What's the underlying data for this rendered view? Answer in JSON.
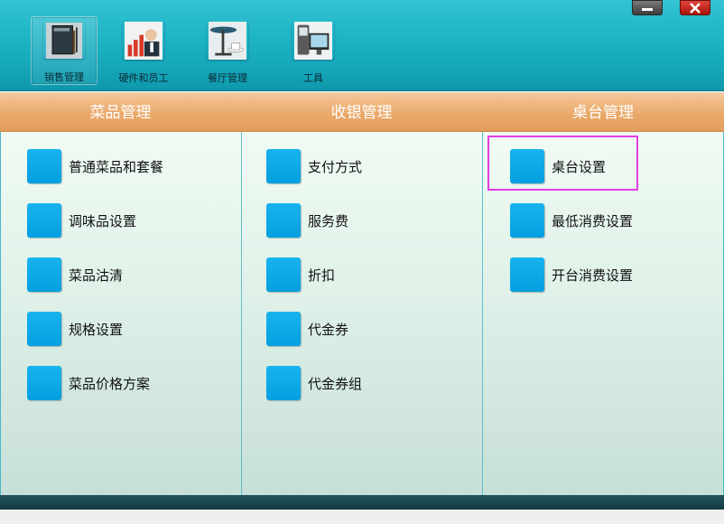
{
  "toolbar": {
    "buttons": [
      {
        "label": "销售管理",
        "icon": "sales-management-icon"
      },
      {
        "label": "硬件和员工",
        "icon": "hardware-staff-icon"
      },
      {
        "label": "餐厅管理",
        "icon": "restaurant-management-icon"
      },
      {
        "label": "工具",
        "icon": "tools-icon"
      }
    ],
    "active_index": 0
  },
  "window_controls": {
    "minimize": "minimize-icon",
    "close": "close-icon"
  },
  "columns": [
    {
      "title": "菜品管理",
      "items": [
        "普通菜品和套餐",
        "调味品设置",
        "菜品沽清",
        "规格设置",
        "菜品价格方案"
      ]
    },
    {
      "title": "收银管理",
      "items": [
        "支付方式",
        "服务费",
        "折扣",
        "代金券",
        "代金券组"
      ]
    },
    {
      "title": "桌台管理",
      "items": [
        "桌台设置",
        "最低消费设置",
        "开台消费设置"
      ]
    }
  ],
  "highlighted_item": "桌台设置",
  "colors": {
    "toolbar": "#1fb4c6",
    "header": "#eaa96a",
    "item_icon": "#049fe0",
    "highlight": "#e13ee6"
  }
}
